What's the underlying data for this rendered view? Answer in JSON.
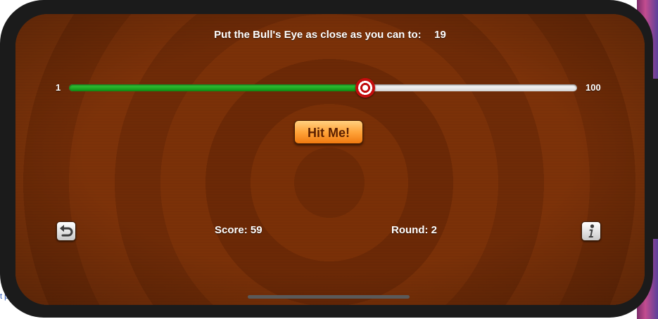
{
  "game": {
    "target_label": "Put the Bull's Eye as close as you can to:",
    "target_value": "19",
    "hit_button_label": "Hit Me!",
    "score_label": "Score:",
    "score_value": "59",
    "round_label": "Round:",
    "round_value": "2"
  },
  "slider": {
    "min_label": "1",
    "max_label": "100",
    "value_fraction": 0.583
  },
  "icons": {
    "start_over": "start-over-icon",
    "info": "info-icon"
  },
  "side_text": "t p",
  "colors": {
    "wood": "#7c3409",
    "slider_fill": "#22b522",
    "button_orange": "#ffa43a",
    "thumb_red": "#c40d0d"
  }
}
